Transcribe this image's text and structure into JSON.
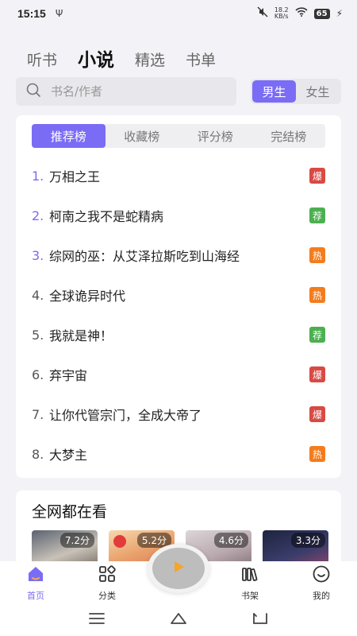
{
  "status_bar": {
    "time": "15:15",
    "usb_icon": "usb-icon",
    "net_speed_value": "18.2",
    "net_speed_unit": "KB/s",
    "battery": "65"
  },
  "top_tabs": [
    {
      "label": "听书",
      "active": false
    },
    {
      "label": "小说",
      "active": true
    },
    {
      "label": "精选",
      "active": false
    },
    {
      "label": "书单",
      "active": false
    }
  ],
  "search": {
    "placeholder": "书名/作者"
  },
  "gender": {
    "male": "男生",
    "female": "女生",
    "selected": "男生"
  },
  "rank_tabs": [
    {
      "label": "推荐榜",
      "active": true
    },
    {
      "label": "收藏榜",
      "active": false
    },
    {
      "label": "评分榜",
      "active": false
    },
    {
      "label": "完结榜",
      "active": false
    }
  ],
  "rank_items": [
    {
      "num": "1.",
      "title": "万相之王",
      "badge": "爆"
    },
    {
      "num": "2.",
      "title": "柯南之我不是蛇精病",
      "badge": "荐"
    },
    {
      "num": "3.",
      "title": "综网的巫：从艾泽拉斯吃到山海经",
      "badge": "热"
    },
    {
      "num": "4.",
      "title": "全球诡异时代",
      "badge": "热"
    },
    {
      "num": "5.",
      "title": "我就是神！",
      "badge": "荐"
    },
    {
      "num": "6.",
      "title": "弃宇宙",
      "badge": "爆"
    },
    {
      "num": "7.",
      "title": "让你代管宗门，全成大帝了",
      "badge": "爆"
    },
    {
      "num": "8.",
      "title": "大梦主",
      "badge": "热"
    }
  ],
  "watch_section": {
    "title": "全网都在看",
    "covers": [
      {
        "score": "7.2分"
      },
      {
        "score": "5.2分"
      },
      {
        "score": "4.6分"
      },
      {
        "score": "3.3分"
      }
    ]
  },
  "bottom_nav": {
    "home": "首页",
    "category": "分类",
    "shelf": "书架",
    "mine": "我的"
  },
  "colors": {
    "accent": "#7b6cf6",
    "badge_hot": "#d84a44",
    "badge_rec": "#4caf50",
    "badge_heat": "#f47c1c"
  }
}
